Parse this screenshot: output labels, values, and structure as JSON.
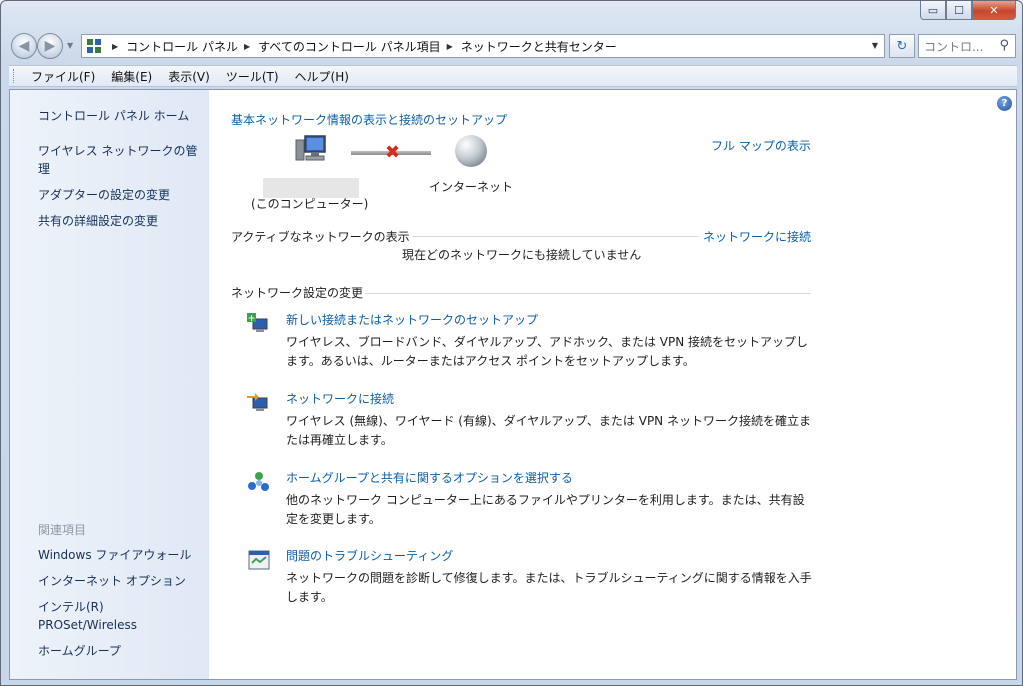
{
  "window": {
    "controls": {
      "minimize": "▭",
      "maximize": "☐",
      "close": "✕"
    }
  },
  "navigation": {
    "breadcrumbs": [
      "コントロール パネル",
      "すべてのコントロール パネル項目",
      "ネットワークと共有センター"
    ],
    "search_placeholder": "コントロ..."
  },
  "menubar": {
    "items": [
      "ファイル(F)",
      "編集(E)",
      "表示(V)",
      "ツール(T)",
      "ヘルプ(H)"
    ]
  },
  "sidebar": {
    "links": [
      "コントロール パネル ホーム",
      "ワイヤレス ネットワークの管理",
      "アダプターの設定の変更",
      "共有の詳細設定の変更"
    ],
    "related_heading": "関連項目",
    "related": [
      "Windows ファイアウォール",
      "インターネット オプション",
      "インテル(R) PROSet/Wireless",
      "ホームグループ"
    ]
  },
  "main": {
    "title": "基本ネットワーク情報の表示と接続のセットアップ",
    "full_map": "フル マップの表示",
    "computer_label": "(このコンピューター)",
    "internet_label": "インターネット",
    "active_networks": "アクティブなネットワークの表示",
    "connect_link": "ネットワークに接続",
    "no_network": "現在どのネットワークにも接続していません",
    "change_settings": "ネットワーク設定の変更",
    "tasks": [
      {
        "title": "新しい接続またはネットワークのセットアップ",
        "desc": "ワイヤレス、ブロードバンド、ダイヤルアップ、アドホック、または VPN 接続をセットアップします。あるいは、ルーターまたはアクセス ポイントをセットアップします。"
      },
      {
        "title": "ネットワークに接続",
        "desc": "ワイヤレス (無線)、ワイヤード (有線)、ダイヤルアップ、または VPN ネットワーク接続を確立または再確立します。"
      },
      {
        "title": "ホームグループと共有に関するオプションを選択する",
        "desc": "他のネットワーク コンピューター上にあるファイルやプリンターを利用します。または、共有設定を変更します。"
      },
      {
        "title": "問題のトラブルシューティング",
        "desc": "ネットワークの問題を診断して修復します。または、トラブルシューティングに関する情報を入手します。"
      }
    ]
  }
}
